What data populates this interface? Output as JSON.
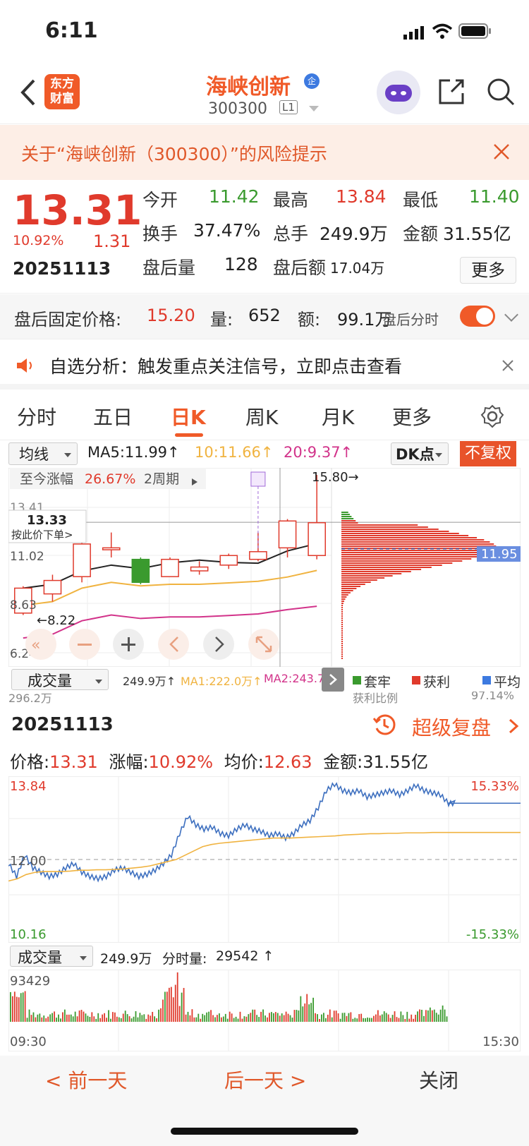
{
  "status": {
    "time": "6:11"
  },
  "header": {
    "logo_line1": "东方",
    "logo_line2": "财富",
    "stock_name": "海峡创新",
    "badge": "企",
    "stock_code": "300300",
    "level": "L1"
  },
  "risk_banner": {
    "text": "关于“海峡创新（300300）”的风险提示"
  },
  "quote": {
    "price": "13.31",
    "change_pct": "10.92%",
    "change": "1.31",
    "date": "20251113",
    "open_label": "今开",
    "open": "11.42",
    "high_label": "最高",
    "high": "13.84",
    "low_label": "最低",
    "low": "11.40",
    "turnover_label": "换手",
    "turnover": "37.47%",
    "volume_label": "总手",
    "volume": "249.9万",
    "amount_label": "金额",
    "amount": "31.55亿",
    "ah_vol_label": "盘后量",
    "ah_vol": "128",
    "ah_amt_label": "盘后额",
    "ah_amt": "17.04万",
    "more": "更多"
  },
  "after_hours": {
    "price_label": "盘后固定价格:",
    "price": "15.20",
    "vol_label": "量:",
    "vol": "652",
    "amt_label": "额:",
    "amt": "99.1万",
    "toggle_label": "盘后分时"
  },
  "watchlist": {
    "text": "自选分析：触发重点关注信号，立即点击查看"
  },
  "tabs": [
    "分时",
    "五日",
    "日K",
    "周K",
    "月K",
    "更多"
  ],
  "kline": {
    "ma_selector": "均线",
    "ma5": "MA5:11.99↑",
    "ma10": "10:11.66↑",
    "ma20": "20:9.37↑",
    "dk_label": "DK点",
    "fq_label": "不复权",
    "overlay_label": "至今涨幅",
    "overlay_value": "26.67%",
    "overlay_period": "2周期",
    "order_price": "13.33",
    "order_hint": "按此价下单>",
    "y_labels": [
      "13.41",
      "11.02",
      "8.63",
      "6.24"
    ],
    "high_mark": "15.80→",
    "low_mark": "←8.22",
    "chip_price": "11.95",
    "vol_selector": "成交量",
    "vol_value": "249.9万↑",
    "vol_ma1": "MA1:222.0万↑",
    "vol_ma2": "MA2:243.7",
    "vol_first_label": "296.2万",
    "chip_legend": [
      "套牢",
      "获利",
      "平均"
    ],
    "chip_ratio_label": "获利比例",
    "chip_ratio": "97.14%",
    "colors": {
      "up": "#e03a2c",
      "down": "#3a9a2e",
      "ma5": "#222222",
      "ma10": "#f0b340",
      "ma20": "#d2338a"
    }
  },
  "chart_data": [
    {
      "type": "candlestick",
      "title": "日K",
      "candles": [
        {
          "o": 8.6,
          "c": 9.9,
          "h": 10.0,
          "l": 8.5
        },
        {
          "o": 9.6,
          "c": 10.3,
          "h": 10.6,
          "l": 9.2
        },
        {
          "o": 10.5,
          "c": 12.2,
          "h": 12.6,
          "l": 10.2
        },
        {
          "o": 11.9,
          "c": 12.0,
          "h": 12.8,
          "l": 11.5
        },
        {
          "o": 11.4,
          "c": 10.2,
          "h": 11.5,
          "l": 10.1
        },
        {
          "o": 10.5,
          "c": 11.4,
          "h": 11.5,
          "l": 10.5
        },
        {
          "o": 10.8,
          "c": 11.0,
          "h": 11.3,
          "l": 10.6
        },
        {
          "o": 11.1,
          "c": 11.6,
          "h": 11.7,
          "l": 10.9
        },
        {
          "o": 11.4,
          "c": 11.8,
          "h": 12.8,
          "l": 11.3
        },
        {
          "o": 12.0,
          "c": 13.4,
          "h": 13.5,
          "l": 11.5
        },
        {
          "o": 11.6,
          "c": 13.31,
          "h": 15.8,
          "l": 11.4
        }
      ],
      "ylim": [
        6.24,
        15.8
      ]
    },
    {
      "type": "line",
      "title": "分时",
      "price_series": [
        11.9,
        11.6,
        12.1,
        11.8,
        11.7,
        11.6,
        11.65,
        11.8,
        11.9,
        11.7,
        11.6,
        11.55,
        11.6,
        11.75,
        11.8,
        11.7,
        11.6,
        11.65,
        11.75,
        11.9,
        12.1,
        12.6,
        13.0,
        12.8,
        12.7,
        12.75,
        12.6,
        12.55,
        12.7,
        12.8,
        12.7,
        12.65,
        12.55,
        12.6,
        12.5,
        12.6,
        12.8,
        12.9,
        13.2,
        13.6,
        13.75,
        13.6,
        13.55,
        13.6,
        13.45,
        13.5,
        13.55,
        13.6,
        13.5,
        13.6,
        13.72,
        13.6,
        13.55,
        13.5,
        13.3,
        13.31,
        13.31,
        13.31,
        13.31
      ],
      "avg_series": [
        11.5,
        11.55,
        11.65,
        11.7,
        11.72,
        11.72,
        11.72,
        11.73,
        11.75,
        11.75,
        11.76,
        11.76,
        11.77,
        11.78,
        11.8,
        11.82,
        11.85,
        11.9,
        11.95,
        12.0,
        12.1,
        12.2,
        12.3,
        12.35,
        12.38,
        12.4,
        12.42,
        12.44,
        12.46,
        12.48,
        12.5,
        12.5,
        12.5,
        12.51,
        12.52,
        12.53,
        12.54,
        12.55,
        12.57,
        12.58,
        12.59,
        12.6,
        12.6,
        12.61,
        12.61,
        12.62,
        12.62,
        12.62,
        12.63,
        12.63,
        12.63,
        12.63,
        12.63,
        12.63,
        12.63,
        12.63,
        12.63,
        12.63,
        12.63
      ],
      "ylim": [
        10.16,
        13.84
      ],
      "prev_close": 12.0,
      "y_labels": {
        "top": "13.84",
        "mid": "12.00",
        "bottom": "10.16",
        "top_pct": "15.33%",
        "bottom_pct": "-15.33%"
      },
      "x_labels": [
        "09:30",
        "15:30"
      ]
    }
  ],
  "intraday": {
    "date": "20251113",
    "replay": "超级复盘",
    "price_label": "价格:",
    "price": "13.31",
    "pct_label": "涨幅:",
    "pct": "10.92%",
    "avg_label": "均价:",
    "avg": "12.63",
    "amount_label": "金额:",
    "amount": "31.55亿",
    "vol_selector": "成交量",
    "vol_total": "249.9万",
    "vol_minute_label": "分时量:",
    "vol_minute": "29542 ↑",
    "vol_max": "93429",
    "colors": {
      "price_line": "#3d6fbf",
      "avg_line": "#f0b340"
    }
  },
  "bottom_nav": {
    "prev": "< 前一天",
    "next": "后一天 >",
    "close": "关闭"
  }
}
